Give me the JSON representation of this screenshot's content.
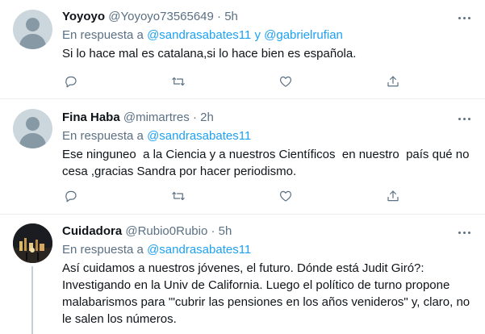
{
  "tweets": [
    {
      "name": "Yoyoyo",
      "handle": "@Yoyoyo73565649",
      "sep": "·",
      "time": "5h",
      "reply_prefix": "En respuesta a ",
      "mentions": [
        "@sandrasabates11",
        "@gabrielrufian"
      ],
      "mention_joiner": " y ",
      "text": "Si lo hace mal es catalana,si lo hace bien es española.",
      "avatar": "default-avatar"
    },
    {
      "name": "Fina Haba",
      "handle": "@mimartres",
      "sep": "·",
      "time": "2h",
      "reply_prefix": "En respuesta a ",
      "mentions": [
        "@sandrasabates11"
      ],
      "text": "Ese ninguneo  a la Ciencia y a nuestros Científicos  en nuestro  país qué no\ncesa ,gracias Sandra por hacer periodismo.",
      "avatar": "default-avatar"
    },
    {
      "name": "Cuidadora",
      "handle": "@Rubio0Rubio",
      "sep": "·",
      "time": "5h",
      "reply_prefix": "En respuesta a ",
      "mentions": [
        "@sandrasabates11"
      ],
      "text": "Así cuidamos a nuestros jóvenes, el futuro. Dónde está Judit Giró?:\nInvestigando en la Univ de California. Luego el político de turno propone\nmalabarismos para '\"cubrir las pensiones en los años venideros\" y, claro, no\nle salen los números.",
      "avatar": "night-city-photo"
    }
  ],
  "icons": {
    "reply": "reply-icon",
    "retweet": "retweet-icon",
    "like": "like-icon",
    "share": "share-icon",
    "more": "more-icon"
  },
  "colors": {
    "link": "#1da1f2",
    "secondary_text": "#5b7083",
    "divider": "#ebeef0"
  }
}
